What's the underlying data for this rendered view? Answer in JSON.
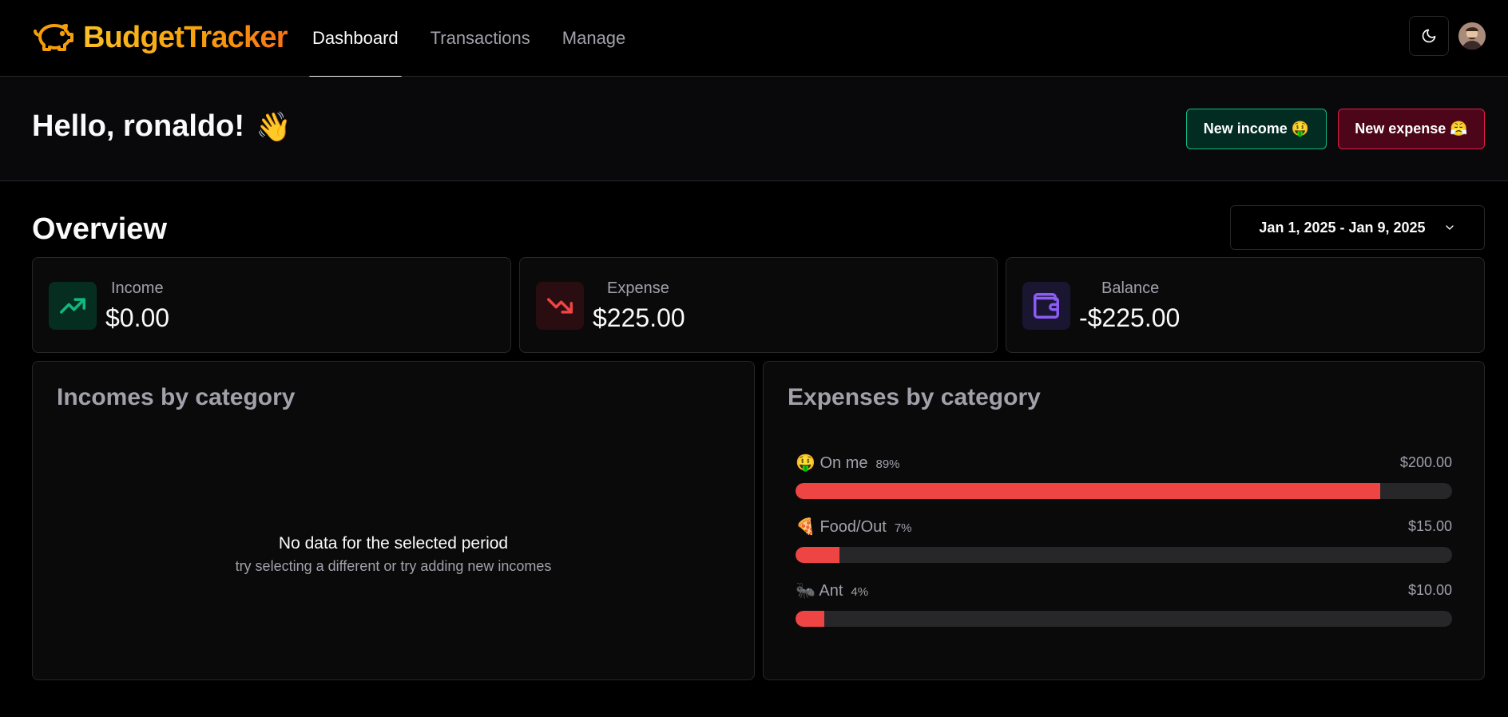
{
  "app": {
    "name": "BudgetTracker"
  },
  "nav": [
    {
      "label": "Dashboard",
      "active": true
    },
    {
      "label": "Transactions",
      "active": false
    },
    {
      "label": "Manage",
      "active": false
    }
  ],
  "header": {
    "theme_icon": "moon-icon",
    "avatar": "user-avatar"
  },
  "greeting": {
    "text": "Hello, ronaldo!",
    "emoji": "👋"
  },
  "actions": {
    "new_income": "New income 🤑",
    "new_expense": "New expense 😤"
  },
  "overview": {
    "title": "Overview",
    "date_range": "Jan 1, 2025 - Jan 9, 2025",
    "stats": [
      {
        "label": "Income",
        "value": "$0.00",
        "icon": "trending-up-icon",
        "color": "#10b981"
      },
      {
        "label": "Expense",
        "value": "$225.00",
        "icon": "trending-down-icon",
        "color": "#ef4444"
      },
      {
        "label": "Balance",
        "value": "-$225.00",
        "icon": "wallet-icon",
        "color": "#8b5cf6"
      }
    ]
  },
  "incomes_by_category": {
    "title": "Incomes by category",
    "empty_title": "No data for the selected period",
    "empty_subtitle": "try selecting a different or try adding new incomes"
  },
  "expenses_by_category": {
    "title": "Expenses by category",
    "bar_color": "#ef4444",
    "items": [
      {
        "name": "🤑 On me",
        "percent_label": "89%",
        "amount": "$200.00",
        "fraction": 0.89
      },
      {
        "name": "🍕 Food/Out",
        "percent_label": "7%",
        "amount": "$15.00",
        "fraction": 0.0667
      },
      {
        "name": "🐜 Ant",
        "percent_label": "4%",
        "amount": "$10.00",
        "fraction": 0.0444
      }
    ]
  }
}
